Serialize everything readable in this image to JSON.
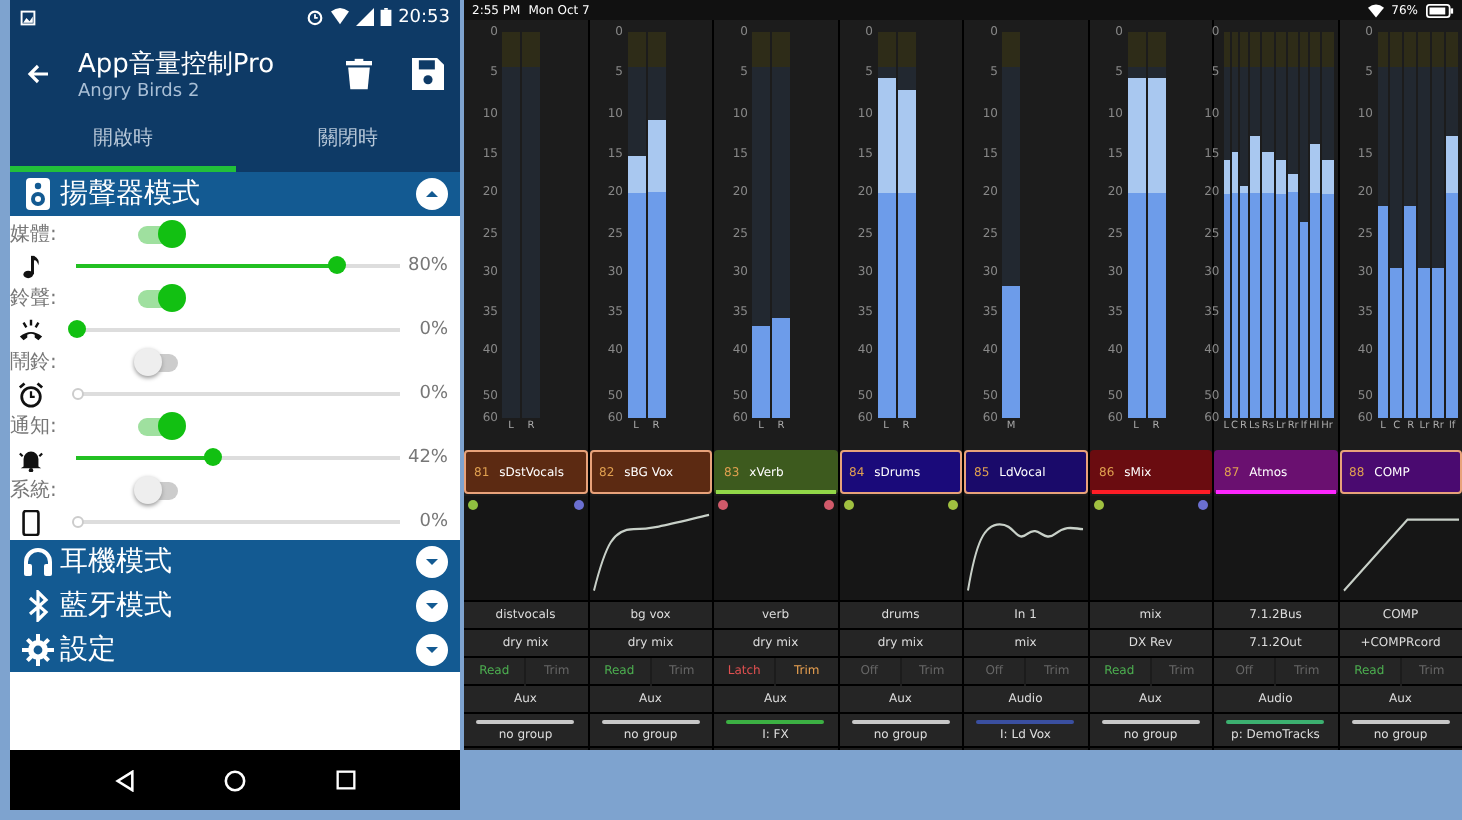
{
  "phone": {
    "status_time": "20:53",
    "title": "App音量控制Pro",
    "subtitle": "Angry Birds 2",
    "tabs": [
      {
        "label": "開啟時",
        "selected": true
      },
      {
        "label": "關閉時",
        "selected": false
      }
    ],
    "sections": [
      {
        "title": "揚聲器模式",
        "expanded": true,
        "items": [
          {
            "label": "媒體:",
            "on": true,
            "level": 0.8,
            "reading": "80%"
          },
          {
            "label": "鈴聲:",
            "on": true,
            "level": 0,
            "reading": "0%"
          },
          {
            "label": "鬧鈴:",
            "on": false,
            "level": 0,
            "reading": "0%"
          },
          {
            "label": "通知:",
            "on": true,
            "level": 0.42,
            "reading": "42%"
          },
          {
            "label": "系統:",
            "on": false,
            "level": 0,
            "reading": "0%"
          }
        ]
      },
      {
        "title": "耳機模式",
        "expanded": false
      },
      {
        "title": "藍牙模式",
        "expanded": false
      },
      {
        "title": "設定",
        "expanded": false
      }
    ]
  },
  "mixer": {
    "time": "2:55 PM",
    "date": "Mon Oct 7",
    "battery": "76%",
    "strips": [
      {
        "number": "81",
        "name": "sDstVocals",
        "color": "#5c2a12",
        "selected": true,
        "scale": [
          "0",
          "5",
          "10",
          "15",
          "20",
          "25",
          "30",
          "35",
          "40",
          "50",
          "60"
        ],
        "meters": [
          {
            "label": "L"
          },
          {
            "label": "R"
          }
        ],
        "dots": [
          {
            "color": "#8fbf40"
          },
          {
            "color": "#6b6fd0"
          }
        ],
        "input": "distvocals",
        "output": "dry mix",
        "automation": {
          "kind": "read",
          "mode": "Read",
          "trim": "Trim",
          "trim_on": false
        },
        "track_type": "Aux",
        "group": {
          "name": "no group",
          "color": "#c8c8c8"
        }
      },
      {
        "number": "82",
        "name": "sBG Vox",
        "color": "#5c2a12",
        "selected": true,
        "scale": [
          "0",
          "5",
          "10",
          "15",
          "20",
          "25",
          "30",
          "35",
          "40",
          "50",
          "60"
        ],
        "meters": [
          {
            "label": "L",
            "level": 0.68
          },
          {
            "label": "R",
            "level": 0.77
          }
        ],
        "input": "bg vox",
        "output": "dry mix",
        "automation": {
          "kind": "read",
          "mode": "Read",
          "trim": "Trim",
          "trim_on": false
        },
        "track_type": "Aux",
        "group": {
          "name": "no group",
          "color": "#c8c8c8"
        }
      },
      {
        "number": "83",
        "name": "xVerb",
        "color": "#3d5a1e",
        "selected": false,
        "scale": [
          "0",
          "5",
          "10",
          "15",
          "20",
          "25",
          "30",
          "35",
          "40",
          "50",
          "60"
        ],
        "meters": [
          {
            "label": "L",
            "level": 0.24
          },
          {
            "label": "R",
            "level": 0.26
          }
        ],
        "dots": [
          {
            "color": "#d05a6a"
          },
          {
            "color": "#d05a6a"
          }
        ],
        "input": "verb",
        "output": "dry mix",
        "automation": {
          "kind": "latch",
          "mode": "Latch",
          "trim": "Trim",
          "trim_on": true
        },
        "track_type": "Aux",
        "group": {
          "name": "I: FX",
          "color": "#3cb043"
        }
      },
      {
        "number": "84",
        "name": "sDrums",
        "color": "#1a0a7a",
        "selected": true,
        "scale": [
          "0",
          "5",
          "10",
          "15",
          "20",
          "25",
          "30",
          "35",
          "40",
          "50",
          "60"
        ],
        "meters": [
          {
            "label": "L",
            "level": 0.88
          },
          {
            "label": "R",
            "level": 0.85
          }
        ],
        "dots": [
          {
            "color": "#a0c040"
          },
          {
            "color": "#a0c040"
          }
        ],
        "input": "drums",
        "output": "dry mix",
        "automation": {
          "kind": "off",
          "mode": "Off",
          "trim": "Trim",
          "trim_on": false
        },
        "track_type": "Aux",
        "group": {
          "name": "no group",
          "color": "#c8c8c8"
        }
      },
      {
        "number": "85",
        "name": "LdVocal",
        "color": "#1a0a6a",
        "selected": true,
        "scale": [
          "0",
          "5",
          "10",
          "15",
          "20",
          "25",
          "30",
          "35",
          "40",
          "50",
          "60"
        ],
        "meters": [
          {
            "label": "M",
            "level": 0.34
          }
        ],
        "input": "In 1",
        "output": "mix",
        "automation": {
          "kind": "off",
          "mode": "Off",
          "trim": "Trim",
          "trim_on": false
        },
        "track_type": "Audio",
        "group": {
          "name": "I: Ld Vox",
          "color": "#3a4fa0"
        }
      },
      {
        "number": "86",
        "name": "sMix",
        "color": "#6a0c10",
        "selected": false,
        "scale": [
          "0",
          "5",
          "10",
          "15",
          "20",
          "25",
          "30",
          "35",
          "40",
          "50",
          "60"
        ],
        "meters": [
          {
            "label": "L",
            "level": 0.88
          },
          {
            "label": "R",
            "level": 0.88
          }
        ],
        "dots": [
          {
            "color": "#a0c040"
          },
          {
            "color": "#6b6fd0"
          }
        ],
        "input": "mix",
        "output": "DX Rev",
        "automation": {
          "kind": "read",
          "mode": "Read",
          "trim": "Trim",
          "trim_on": false
        },
        "track_type": "Aux",
        "group": {
          "name": "no group",
          "color": "#c8c8c8"
        }
      },
      {
        "number": "87",
        "name": "Atmos",
        "color": "#6a1070",
        "selected": false,
        "scale": [
          "0",
          "5",
          "10",
          "15",
          "20",
          "25",
          "30",
          "35",
          "40",
          "50",
          "60"
        ],
        "meters": [
          {
            "label": "L",
            "level": 0.67
          },
          {
            "label": "C",
            "level": 0.69
          },
          {
            "label": "R",
            "level": 0.6
          },
          {
            "label": "Ls",
            "level": 0.73
          },
          {
            "label": "Rs",
            "level": 0.69
          },
          {
            "label": "Lr",
            "level": 0.67
          },
          {
            "label": "Rr",
            "level": 0.63
          },
          {
            "label": "lf",
            "level": 0.51
          },
          {
            "label": "Hl",
            "level": 0.71
          },
          {
            "label": "Hr",
            "level": 0.67
          }
        ],
        "input": "7.1.2Bus",
        "output": "7.1.2Out",
        "automation": {
          "kind": "off",
          "mode": "Off",
          "trim": "Trim",
          "trim_on": false
        },
        "track_type": "Audio",
        "group": {
          "name": "p: DemoTracks",
          "color": "#3cb070"
        }
      },
      {
        "number": "88",
        "name": "COMP",
        "color": "#4a0a70",
        "selected": true,
        "scale": [
          "0",
          "5",
          "10",
          "15",
          "20",
          "25",
          "30",
          "35",
          "40",
          "50",
          "60"
        ],
        "meters": [
          {
            "label": "L",
            "level": 0.55
          },
          {
            "label": "C",
            "level": 0.39
          },
          {
            "label": "R",
            "level": 0.55
          },
          {
            "label": "Lr",
            "level": 0.39
          },
          {
            "label": "Rr",
            "level": 0.39
          },
          {
            "label": "lf",
            "level": 0.73
          }
        ],
        "input": "COMP",
        "output": "+COMPRcord",
        "automation": {
          "kind": "read",
          "mode": "Read",
          "trim": "Trim",
          "trim_on": false
        },
        "track_type": "Aux",
        "group": {
          "name": "no group",
          "color": "#c8c8c8"
        }
      }
    ]
  }
}
